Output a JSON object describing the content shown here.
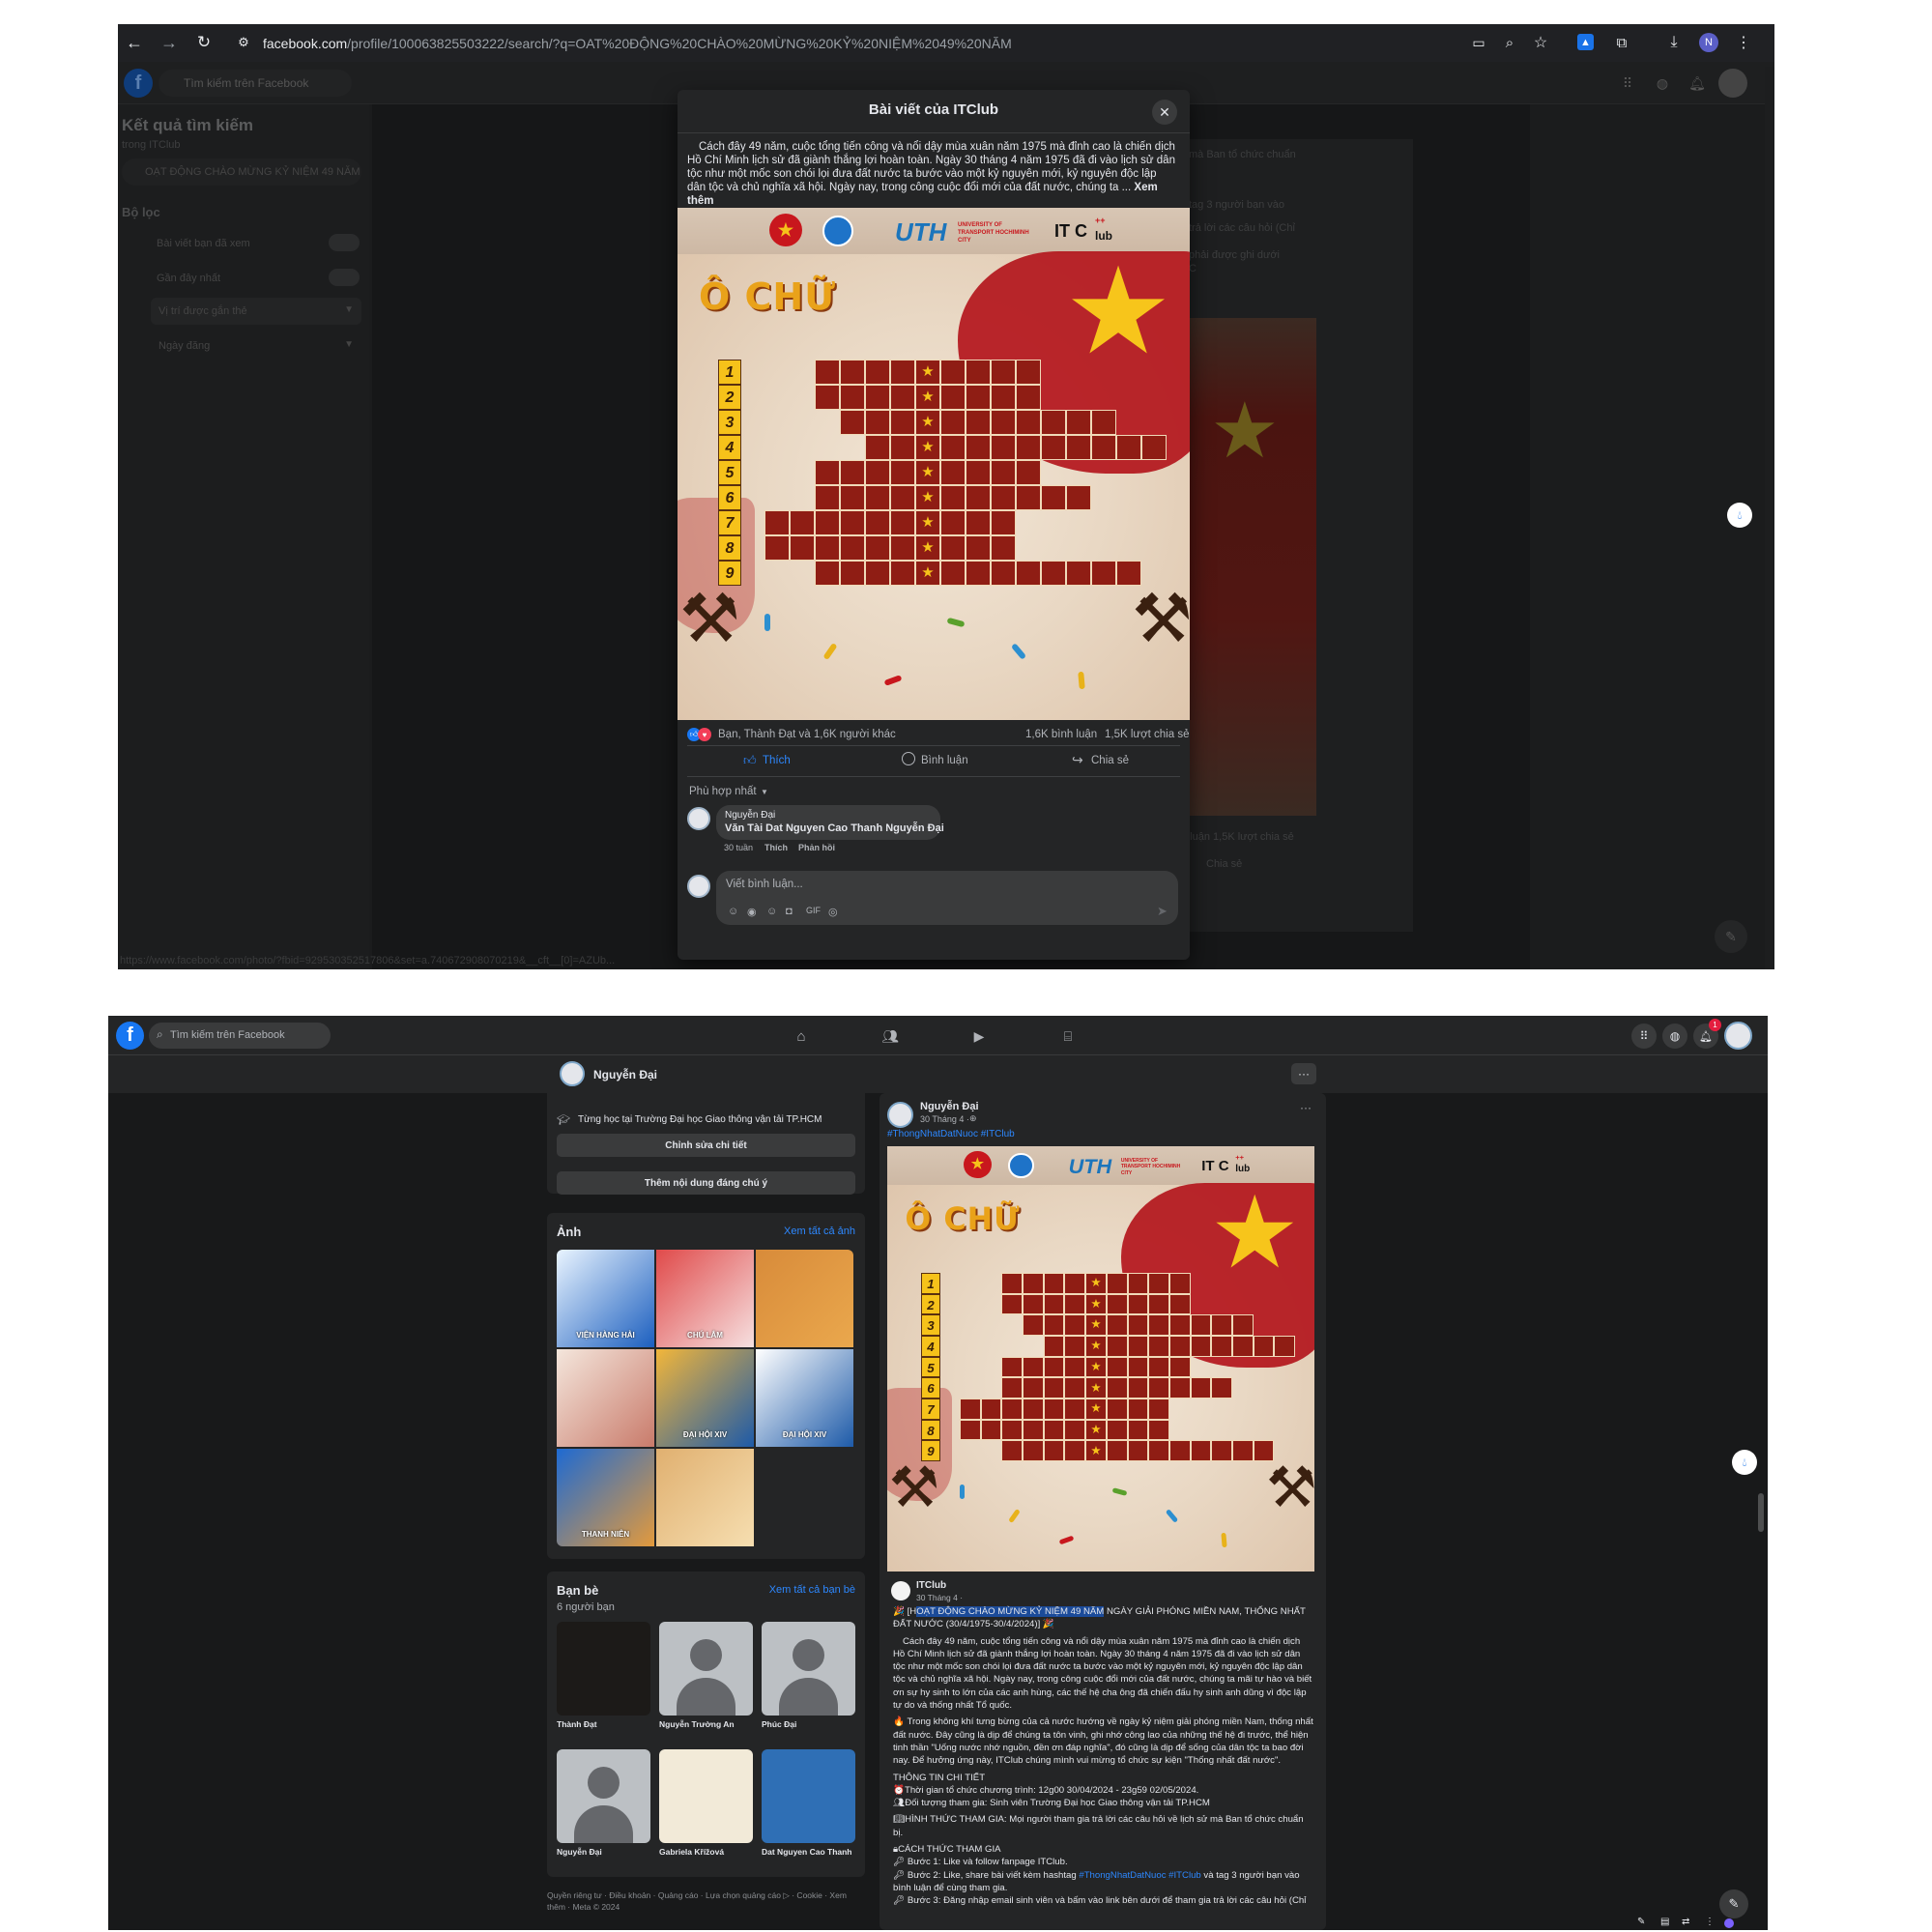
{
  "top": {
    "url_domain": "facebook.com",
    "url_path": "/profile/100063825503222/search/?q=OAT%20ĐỘNG%20CHÀO%20MỪNG%20KỶ%20NIỆM%2049%20NĂM",
    "search_placeholder": "Tìm kiếm trên Facebook",
    "profile_initial": "N",
    "sidebar": {
      "title": "Kết quả tìm kiếm",
      "subtitle": "trong ITClub",
      "query": "OẠT ĐỘNG CHÀO MỪNG KỶ NIỆM 49 NĂM",
      "filter_heading": "Bộ lọc",
      "filters": [
        "Bài viết bạn đã xem",
        "Gần đây nhất"
      ],
      "selects": [
        "Vị trí được gắn thẻ",
        "Ngày đăng"
      ]
    },
    "bg_snippets": [
      "mà Ban tổ chức chuẩn",
      "tag 3 người bạn vào",
      "trả lời các câu hỏi (Chỉ",
      "phải được ghi dưới",
      "C"
    ],
    "bg_stats": "n luận   1,5K lượt chia sẻ",
    "bg_share": "Chia sẻ",
    "status_url": "https://www.facebook.com/photo/?fbid=929530352517806&set=a.740672908070219&__cft__[0]=AZUb...",
    "modal": {
      "title": "Bài viết của ITClub",
      "body": "Cách đây 49 năm, cuộc tổng tiến công và nổi dậy mùa xuân năm 1975 mà đỉnh cao là chiến dịch Hồ Chí Minh lịch sử đã giành thắng lợi hoàn toàn. Ngày 30 tháng 4 năm 1975 đã đi vào lịch sử dân tộc như một mốc son chói lọi đưa đất nước ta bước vào một kỷ nguyên mới, kỷ nguyên độc lập dân tộc và chủ nghĩa xã hội. Ngày nay, trong công cuộc đổi mới của đất nước, chúng ta ...",
      "see_more": "Xem thêm",
      "reactions": "Bạn, Thành Đạt và 1,6K người khác",
      "comments_count": "1,6K bình luận",
      "shares_count": "1,5K lượt chia sẻ",
      "like": "Thích",
      "comment": "Bình luận",
      "share": "Chia sẻ",
      "sort": "Phù hợp nhất",
      "comment_author": "Nguyễn Đại",
      "comment_text": "Văn Tài Dat Nguyen Cao Thanh Nguyễn Đại",
      "comment_time": "30 tuần",
      "comment_like": "Thích",
      "comment_reply": "Phản hồi",
      "write_placeholder": "Viết bình luận..."
    }
  },
  "poster": {
    "org_logo_text": "UTH",
    "org_logo_sub": "UNIVERSITY OF TRANSPORT HOCHIMINH CITY",
    "club_logo": "IT C",
    "club_logo_sup": "++",
    "club_logo_lub": "lub",
    "title": "Ô CHỮ",
    "row_numbers": [
      "1",
      "2",
      "3",
      "4",
      "5",
      "6",
      "7",
      "8",
      "9"
    ]
  },
  "bottom": {
    "search_placeholder": "Tìm kiếm trên Facebook",
    "notif_count": "1",
    "profile_name": "Nguyễn Đại",
    "edu": "Từng học tại Trường Đại học Giao thông vận tải TP.HCM",
    "edit_details": "Chỉnh sửa chi tiết",
    "add_featured": "Thêm nội dung đáng chú ý",
    "photos_title": "Ảnh",
    "photos_all": "Xem tất cả ảnh",
    "photo_texts": [
      "VIỆN HÀNG HẢI",
      "CHÚ LẮM",
      "",
      "",
      "ĐẠI HỘI XIV",
      "ĐẠI HỘI XIV",
      "THANH NIÊN",
      ""
    ],
    "friends_title": "Bạn bè",
    "friends_all": "Xem tất cả bạn bè",
    "friends_count": "6 người bạn",
    "friends": [
      "Thành Đạt",
      "Nguyễn Trường An",
      "Phúc Đại",
      "Nguyễn Đại",
      "Gabriela Křížová",
      "Dat Nguyen Cao Thanh"
    ],
    "footer": "Quyền riêng tư · Điều khoản · Quảng cáo · Lựa chọn quảng cáo ▷ · Cookie · Xem thêm · Meta © 2024",
    "post": {
      "author": "Nguyễn Đại",
      "time": "30 Tháng 4 ·",
      "hashtags": "#ThongNhatDatNuoc #ITClub",
      "shared_author": "ITClub",
      "shared_time": "30 Tháng 4 ·",
      "headline_pre": "[H",
      "headline_highlight": "OẠT ĐỘNG CHÀO MỪNG KỶ NIỆM 49 NĂM",
      "headline_post": " NGÀY GIẢI PHÓNG MIỀN NAM, THỐNG NHẤT ĐẤT NƯỚC (30/4/1975-30/4/2024)]",
      "para1": "Cách đây 49 năm, cuộc tổng tiến công và nổi dậy mùa xuân năm 1975 mà đỉnh cao là chiến dịch Hồ Chí Minh lịch sử đã giành thắng lợi hoàn toàn. Ngày 30 tháng 4 năm 1975 đã đi vào lịch sử dân tộc như một mốc son chói lọi đưa đất nước ta bước vào một kỷ nguyên mới, kỷ nguyên độc lập dân tộc và chủ nghĩa xã hội. Ngày nay, trong công cuộc đổi mới của đất nước, chúng ta mãi tự hào và biết ơn sự hy sinh to lớn của các anh hùng, các thế hệ cha ông đã chiến đấu hy sinh anh dũng vì độc lập tự do và thống nhất Tổ quốc.",
      "para2": "Trong không khí tưng bừng của cả nước hướng về ngày kỷ niệm giải phóng miền Nam, thống nhất đất nước. Đây cũng là dịp để chúng ta tôn vinh, ghi nhớ công lao của những thế hệ đi trước, thể hiện tinh thần \"Uống nước nhớ nguồn, đền ơn đáp nghĩa\", đó cũng là dịp để sống của dân tộc ta bao đời nay. Để hưởng ứng này, ITClub chúng mình vui mừng tổ chức sự kiện \"Thống nhất đất nước\".",
      "info_title": "THÔNG TIN CHI TIẾT",
      "info1": "Thời gian tổ chức chương trình: 12g00 30/04/2024 - 23g59 02/05/2024.",
      "info2": "Đối tượng tham gia: Sinh viên Trường Đại học Giao thông vận tải TP.HCM",
      "info3": "HÌNH THỨC THAM GIA: Mọi người tham gia trả lời các câu hỏi về lịch sử mà Ban tổ chức chuẩn bị.",
      "how_title": "CÁCH THỨC THAM GIA",
      "step1": "Bước 1: Like và follow fanpage ITClub.",
      "step2_pre": "Bước 2: Like, share bài viết kèm hashtag ",
      "step2_tags": "#ThongNhatDatNuoc #ITClub",
      "step2_post": " và tag 3 người bạn vào bình luận để cùng tham gia.",
      "step3": "Bước 3: Đăng nhập email sinh viên và bấm vào link bên dưới để tham gia trả lời các câu hỏi (Chỉ"
    }
  },
  "colors": {
    "fb_blue": "#1877f2",
    "dark_bg": "#18191a",
    "card_bg": "#242526",
    "poster_red": "#8f1d14",
    "star_gold": "#f6c21a"
  }
}
